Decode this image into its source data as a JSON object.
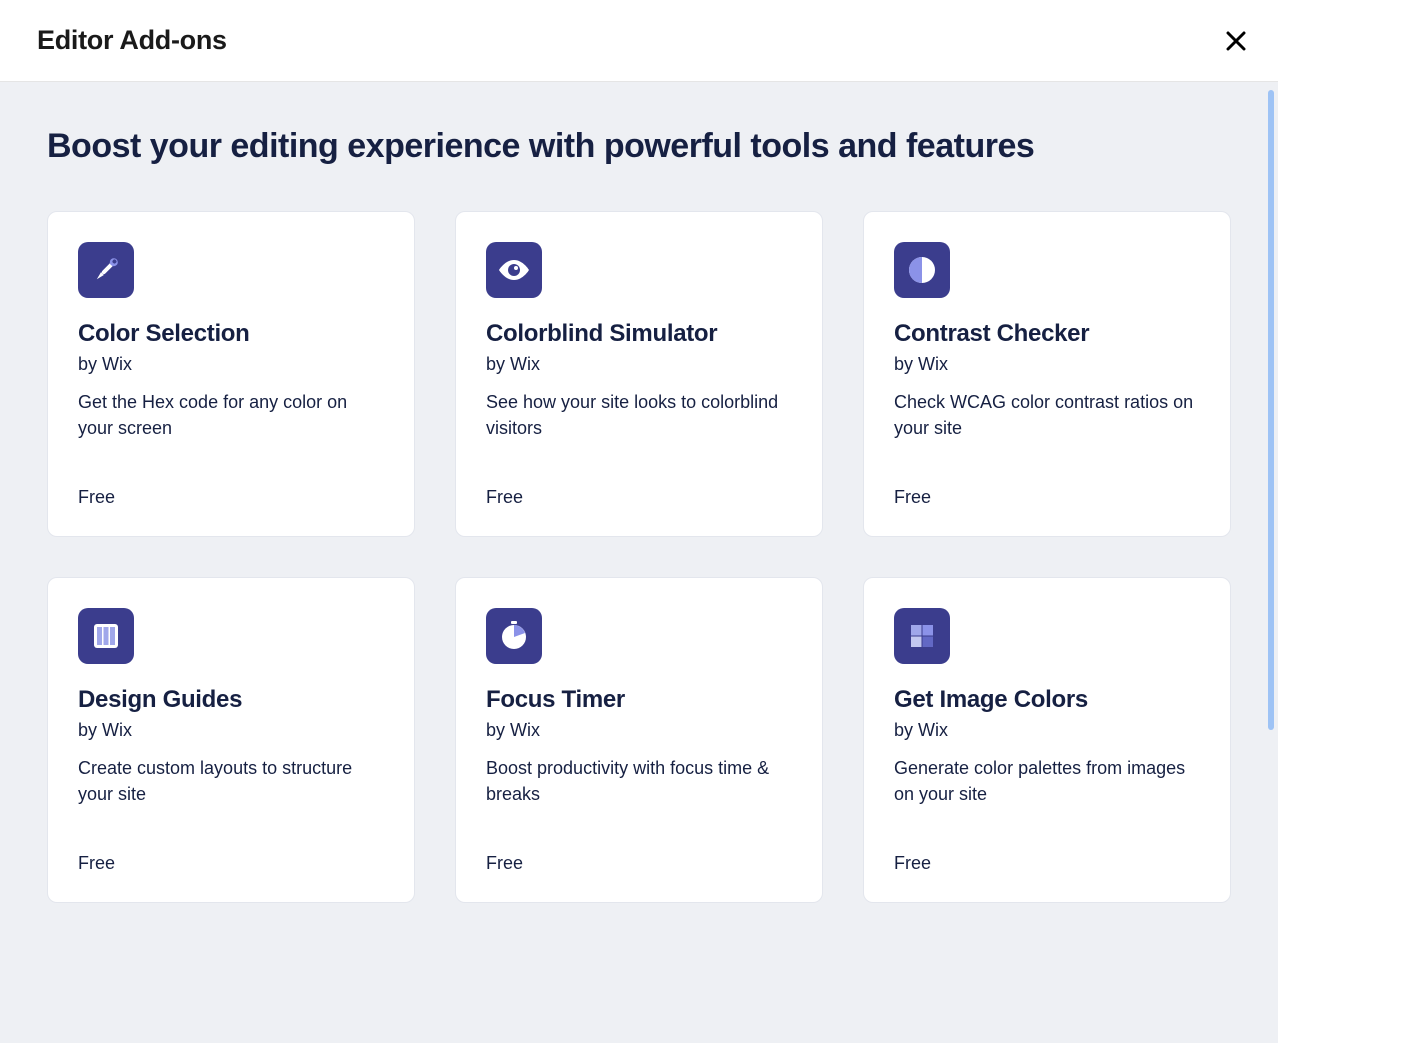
{
  "header": {
    "title": "Editor Add-ons"
  },
  "subtitle": "Boost your editing experience with powerful tools and features",
  "cards": [
    {
      "icon": "eyedropper-icon",
      "title": "Color Selection",
      "author": "by Wix",
      "desc": "Get the Hex code for any color on your screen",
      "price": "Free"
    },
    {
      "icon": "eye-icon",
      "title": "Colorblind Simulator",
      "author": "by Wix",
      "desc": "See how your site looks to colorblind visitors",
      "price": "Free"
    },
    {
      "icon": "contrast-icon",
      "title": "Contrast Checker",
      "author": "by Wix",
      "desc": "Check WCAG color contrast ratios on your site",
      "price": "Free"
    },
    {
      "icon": "columns-icon",
      "title": "Design Guides",
      "author": "by Wix",
      "desc": "Create custom layouts to structure your site",
      "price": "Free"
    },
    {
      "icon": "timer-icon",
      "title": "Focus Timer",
      "author": "by Wix",
      "desc": "Boost productivity with focus time & breaks",
      "price": "Free"
    },
    {
      "icon": "swatch-icon",
      "title": "Get Image Colors",
      "author": "by Wix",
      "desc": "Generate color palettes from images on your site",
      "price": "Free"
    }
  ]
}
